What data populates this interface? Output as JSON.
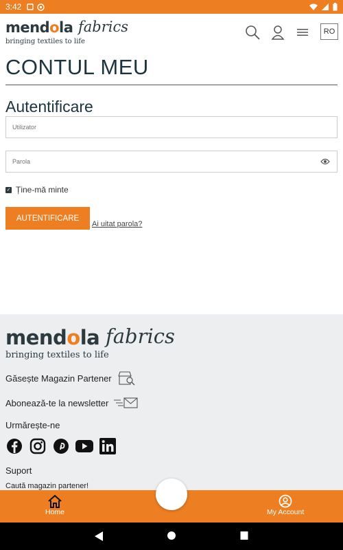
{
  "status_bar": {
    "time": "3:42"
  },
  "header": {
    "brand_name": "mendola",
    "brand_sub": "fabrics",
    "tagline": "bringing textiles to life",
    "language": "RO",
    "icons": [
      "search-icon",
      "user-icon",
      "menu-icon"
    ]
  },
  "main": {
    "page_title": "CONTUL MEU",
    "section_title": "Autentificare",
    "username_placeholder": "Utilizator",
    "password_placeholder": "Parola",
    "remember_label": "Ține-mă minte",
    "remember_checked": true,
    "login_button": "AUTENTIFICARE",
    "forgot_link": "Ai uitat parola?"
  },
  "footer": {
    "brand_name": "mendola",
    "brand_sub": "fabrics",
    "tagline": "bringing textiles to life",
    "find_store": "Găsește Magazin Partener",
    "newsletter": "Abonează-te la newsletter",
    "follow_us": "Urmărește-ne",
    "social": [
      "facebook-icon",
      "instagram-icon",
      "pinterest-icon",
      "youtube-icon",
      "linkedin-icon"
    ],
    "support_title": "Suport",
    "support_link": "Caută magazin partener!"
  },
  "bottom_nav": {
    "home_label": "Home",
    "account_label": "My Account"
  },
  "colors": {
    "accent": "#ed7f22",
    "dark": "#1d3340",
    "footer_bg": "#eceef0"
  }
}
